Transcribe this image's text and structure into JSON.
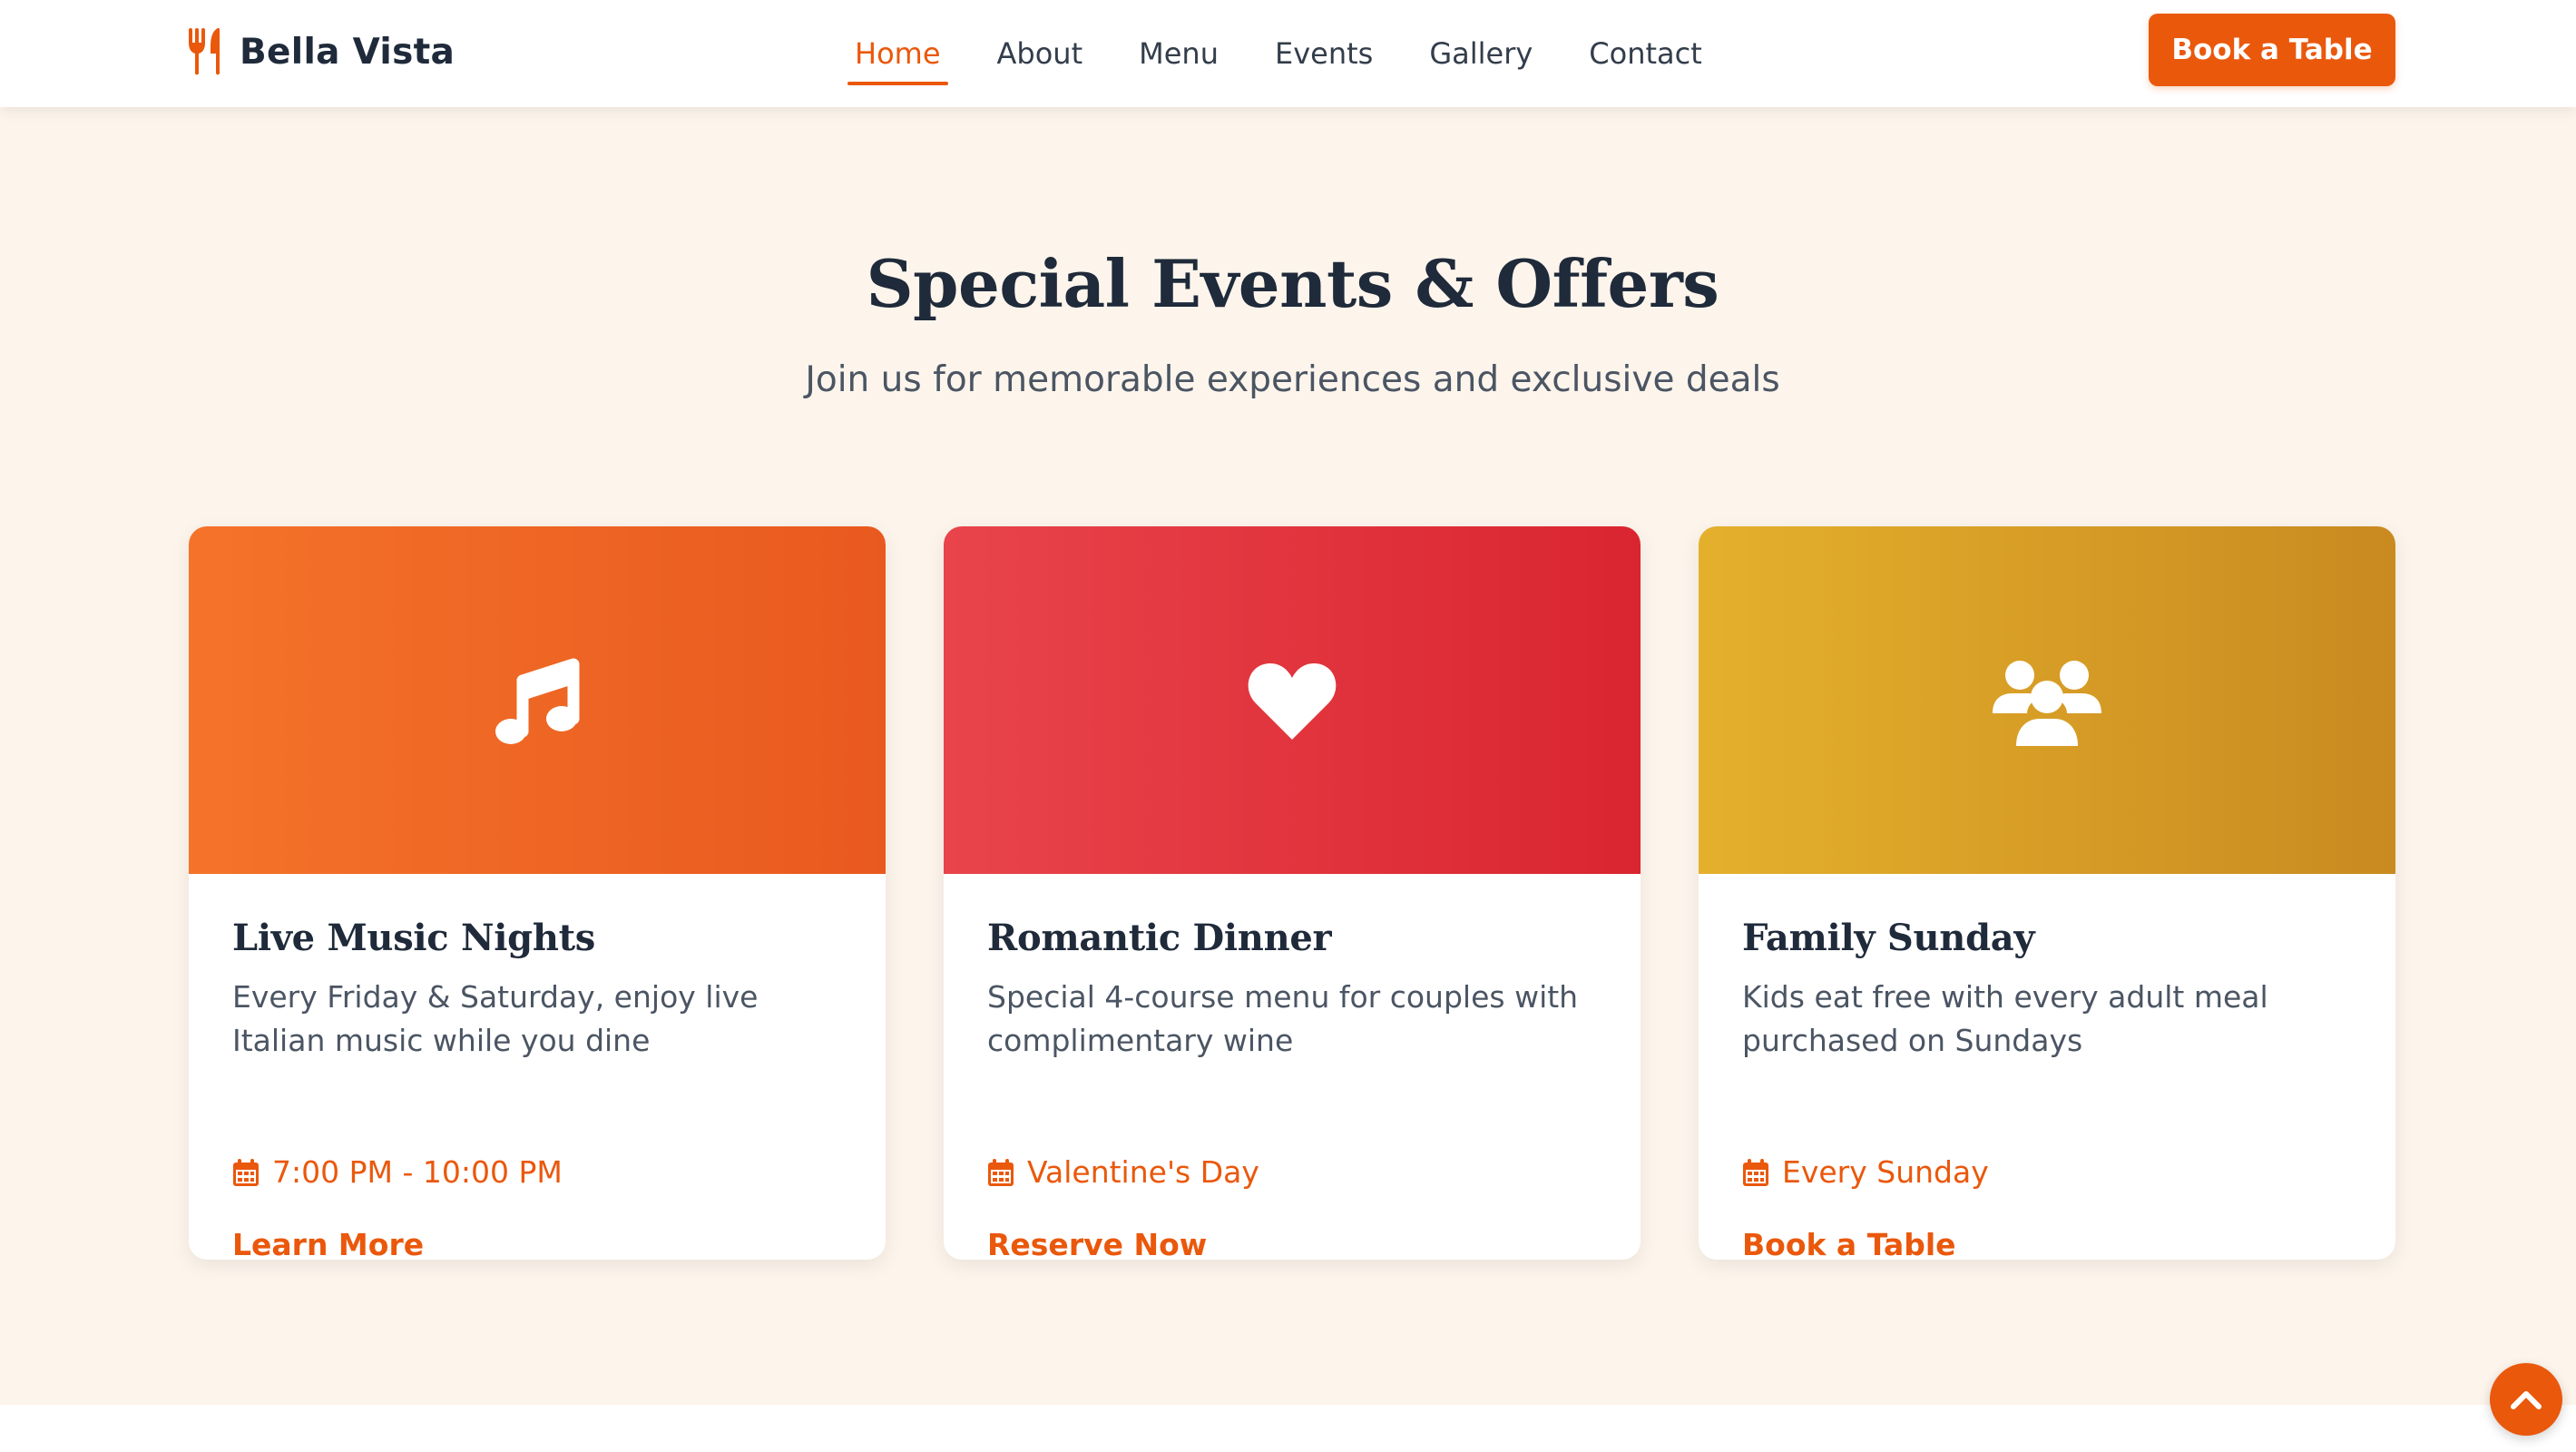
{
  "brand": {
    "name": "Bella Vista",
    "icon": "utensils-icon",
    "accent_color": "#ea580c"
  },
  "nav": {
    "items": [
      {
        "label": "Home",
        "active": true
      },
      {
        "label": "About",
        "active": false
      },
      {
        "label": "Menu",
        "active": false
      },
      {
        "label": "Events",
        "active": false
      },
      {
        "label": "Gallery",
        "active": false
      },
      {
        "label": "Contact",
        "active": false
      }
    ],
    "cta_label": "Book a Table"
  },
  "section": {
    "title": "Special Events & Offers",
    "subtitle": "Join us for memorable experiences and exclusive deals"
  },
  "events": [
    {
      "title": "Live Music Nights",
      "description": "Every Friday & Saturday, enjoy live Italian music while you dine",
      "schedule": "7:00 PM - 10:00 PM",
      "link_label": "Learn More",
      "icon": "music-note-icon",
      "banner_colors": [
        "#f4732a",
        "#e9591f"
      ]
    },
    {
      "title": "Romantic Dinner",
      "description": "Special 4-course menu for couples with complimentary wine",
      "schedule": "Valentine's Day",
      "link_label": "Reserve Now",
      "icon": "heart-icon",
      "banner_colors": [
        "#e9444b",
        "#da2530"
      ]
    },
    {
      "title": "Family Sunday",
      "description": "Kids eat free with every adult meal purchased on Sundays",
      "schedule": "Every Sunday",
      "link_label": "Book a Table",
      "icon": "users-icon",
      "banner_colors": [
        "#e4b02c",
        "#c98a20"
      ]
    }
  ],
  "scroll_top": {
    "icon": "chevron-up-icon"
  }
}
